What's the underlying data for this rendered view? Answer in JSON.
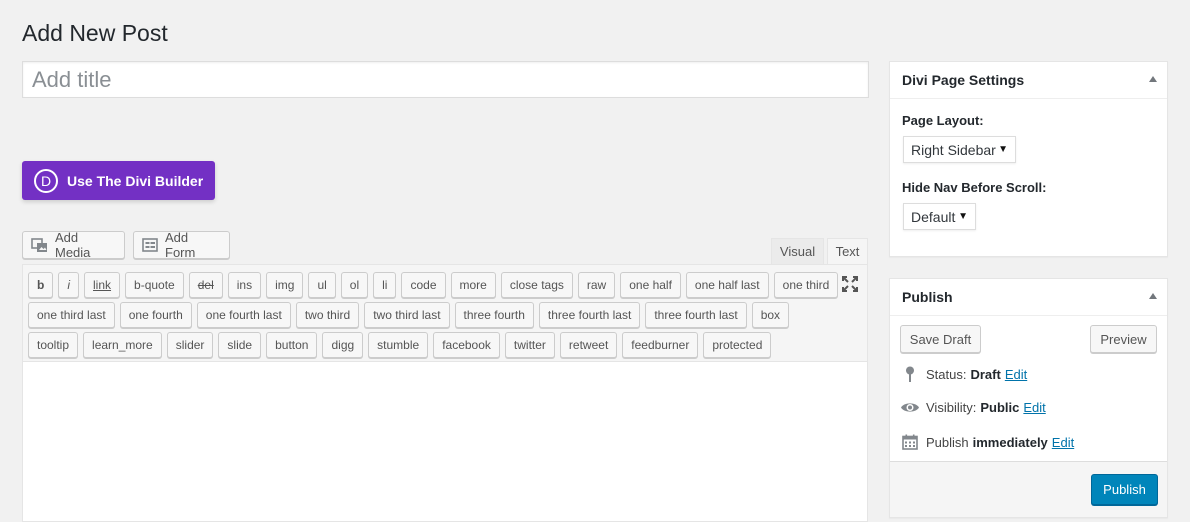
{
  "page": {
    "title": "Add New Post"
  },
  "title_input": {
    "placeholder": "Add title",
    "value": ""
  },
  "divi": {
    "logo_letter": "D",
    "button_label": "Use The Divi Builder",
    "brand_color": "#7330c4"
  },
  "media": {
    "add_media_label": "Add Media",
    "add_form_label": "Add Form"
  },
  "editor": {
    "tabs": [
      {
        "label": "Visual",
        "active": false
      },
      {
        "label": "Text",
        "active": true
      }
    ],
    "quicktags_row1": [
      "b",
      "i",
      "link",
      "b-quote",
      "del",
      "ins",
      "img",
      "ul",
      "ol",
      "li",
      "code",
      "more",
      "close tags",
      "raw",
      "one half",
      "one half last",
      "one third"
    ],
    "quicktags_row2": [
      "one third last",
      "one fourth",
      "one fourth last",
      "two third",
      "two third last",
      "three fourth",
      "three fourth last",
      "three fourth last",
      "box"
    ],
    "quicktags_row3": [
      "tooltip",
      "learn_more",
      "slider",
      "slide",
      "button",
      "digg",
      "stumble",
      "facebook",
      "twitter",
      "retweet",
      "feedburner",
      "protected"
    ],
    "fullscreen_icon": "fullscreen-icon"
  },
  "divi_settings": {
    "title": "Divi Page Settings",
    "page_layout_label": "Page Layout:",
    "page_layout_value": "Right Sidebar",
    "hide_nav_label": "Hide Nav Before Scroll:",
    "hide_nav_value": "Default"
  },
  "publish": {
    "title": "Publish",
    "save_draft_label": "Save Draft",
    "preview_label": "Preview",
    "status_label": "Status:",
    "status_value": "Draft",
    "visibility_label": "Visibility:",
    "visibility_value": "Public",
    "publish_label": "Publish",
    "publish_value": "immediately",
    "edit_label": "Edit",
    "publish_button_label": "Publish",
    "accent_color": "#0085ba"
  }
}
